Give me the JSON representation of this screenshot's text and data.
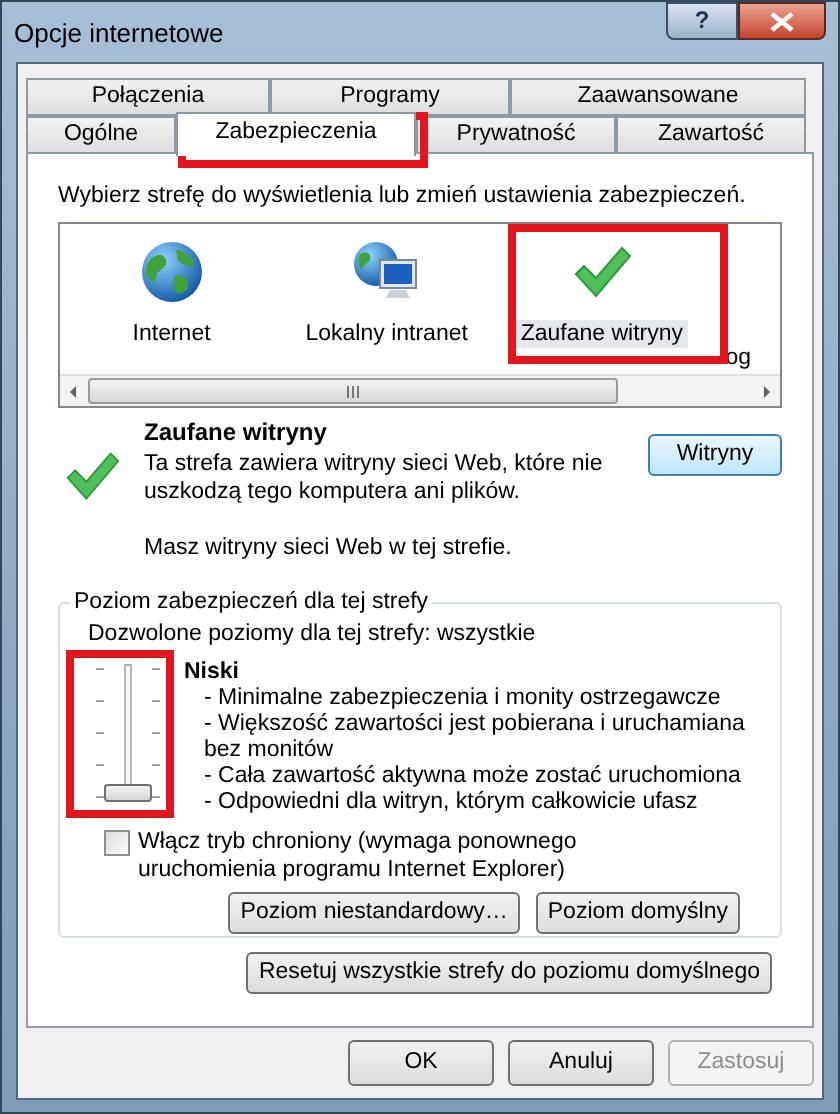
{
  "window": {
    "title": "Opcje internetowe",
    "help_button": "?"
  },
  "tab_rows": [
    [
      {
        "label": "Połączenia",
        "selected": false
      },
      {
        "label": "Programy",
        "selected": false
      },
      {
        "label": "Zaawansowane",
        "selected": false
      }
    ],
    [
      {
        "label": "Ogólne",
        "selected": false
      },
      {
        "label": "Zabezpieczenia",
        "selected": true
      },
      {
        "label": "Prywatność",
        "selected": false
      },
      {
        "label": "Zawartość",
        "selected": false
      }
    ]
  ],
  "zone_prompt": "Wybierz strefę do wyświetlenia lub zmień ustawienia zabezpieczeń.",
  "zones": [
    {
      "kind": "globe",
      "label": "Internet",
      "selected": false
    },
    {
      "kind": "intranet",
      "label": "Lokalny intranet",
      "selected": false
    },
    {
      "kind": "check",
      "label": "Zaufane witryny",
      "selected": true
    },
    {
      "kind": "cut",
      "label": "og",
      "selected": false
    }
  ],
  "zone_info": {
    "title": "Zaufane witryny",
    "description": "Ta strefa zawiera witryny sieci Web, które nie uszkodzą tego komputera ani plików.",
    "note": "Masz witryny sieci Web w tej strefie.",
    "button": "Witryny"
  },
  "security_level": {
    "legend": "Poziom zabezpieczeń dla tej strefy",
    "allowed": "Dozwolone poziomy dla tej strefy: wszystkie",
    "level": 0,
    "level_name": "Niski",
    "bullets": [
      "- Minimalne zabezpieczenia i monity ostrzegawcze",
      "- Większość zawartości jest pobierana i uruchamiana bez monitów",
      "- Cała zawartość aktywna może zostać uruchomiona",
      "- Odpowiedni dla witryn, którym całkowicie ufasz"
    ],
    "protected_mode": {
      "label": "Włącz tryb chroniony (wymaga ponownego uruchomienia programu Internet Explorer)",
      "checked": false
    },
    "buttons": [
      "Poziom niestandardowy…",
      "Poziom domyślny"
    ]
  },
  "reset_button": "Resetuj wszystkie strefy do poziomu domyślnego",
  "dialog_buttons": [
    {
      "label": "OK",
      "disabled": false
    },
    {
      "label": "Anuluj",
      "disabled": false
    },
    {
      "label": "Zastosuj",
      "disabled": true
    }
  ]
}
